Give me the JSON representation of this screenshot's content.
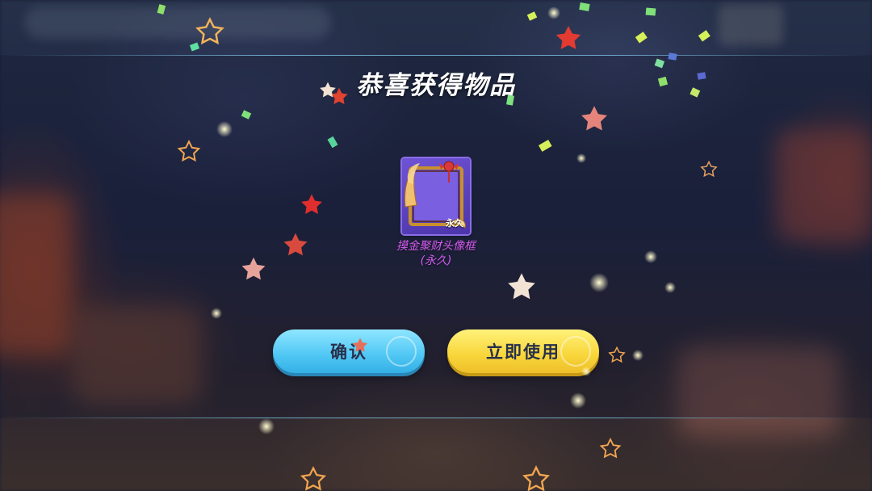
{
  "dialog": {
    "title": "恭喜获得物品"
  },
  "reward": {
    "name_line1": "摸金聚财头像框",
    "name_line2": "(永久)",
    "duration_tag": "永久",
    "rarity_color": "#6f53d6"
  },
  "buttons": {
    "confirm_label": "确认",
    "use_now_label": "立即使用"
  },
  "colors": {
    "confirm_button": "#4fc6f4",
    "use_button": "#f8d53a",
    "item_name": "#d55cf0"
  }
}
